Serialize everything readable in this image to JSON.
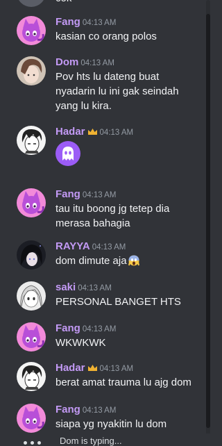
{
  "colors": {
    "background": "#313338",
    "username_purple": "#c39af5",
    "crown_gold": "#f0b232",
    "timestamp": "#949ba4",
    "message_text": "#f2f3f5"
  },
  "top_partial": {
    "text": "cok"
  },
  "messages": [
    {
      "author": "Fang",
      "avatar": "pink-cat-avatar",
      "time": "04:13 AM",
      "lines": [
        "kasian co orang polos"
      ]
    },
    {
      "author": "Dom",
      "avatar": "anime-boy-avatar",
      "time": "04:13 AM",
      "lines": [
        "Pov hts lu dateng buat",
        "nyadarin lu ini gak seindah",
        "yang lu kira."
      ]
    },
    {
      "author": "Hadar",
      "avatar": "manga-boy-avatar",
      "owner_badge": "crown-icon",
      "time": "04:13 AM",
      "attachment": "purple-ghost-emoji"
    },
    {
      "author": "Fang",
      "avatar": "pink-cat-avatar",
      "time": "04:13 AM",
      "lines": [
        "tau itu boong jg tetep dia",
        "merasa bahagia"
      ]
    },
    {
      "author": "RAYYA",
      "avatar": "dark-hair-avatar",
      "time": "04:13 AM",
      "lines": [
        "dom dimute aja"
      ],
      "inline_emoji": "screaming-face-emoji"
    },
    {
      "author": "saki",
      "avatar": "manga-girl-avatar",
      "time": "04:13 AM",
      "lines": [
        "PERSONAL BANGET HTS"
      ]
    },
    {
      "author": "Fang",
      "avatar": "pink-cat-avatar",
      "time": "04:13 AM",
      "lines": [
        "WKWKWK"
      ]
    },
    {
      "author": "Hadar",
      "avatar": "manga-boy-avatar",
      "owner_badge": "crown-icon",
      "time": "04:13 AM",
      "lines": [
        "berat amat trauma lu ajg dom"
      ]
    },
    {
      "author": "Fang",
      "avatar": "pink-cat-avatar",
      "time": "04:13 AM",
      "lines": [
        "siapa yg nyakitin lu dom"
      ]
    }
  ],
  "typing": {
    "text": "Dom is typing..."
  }
}
